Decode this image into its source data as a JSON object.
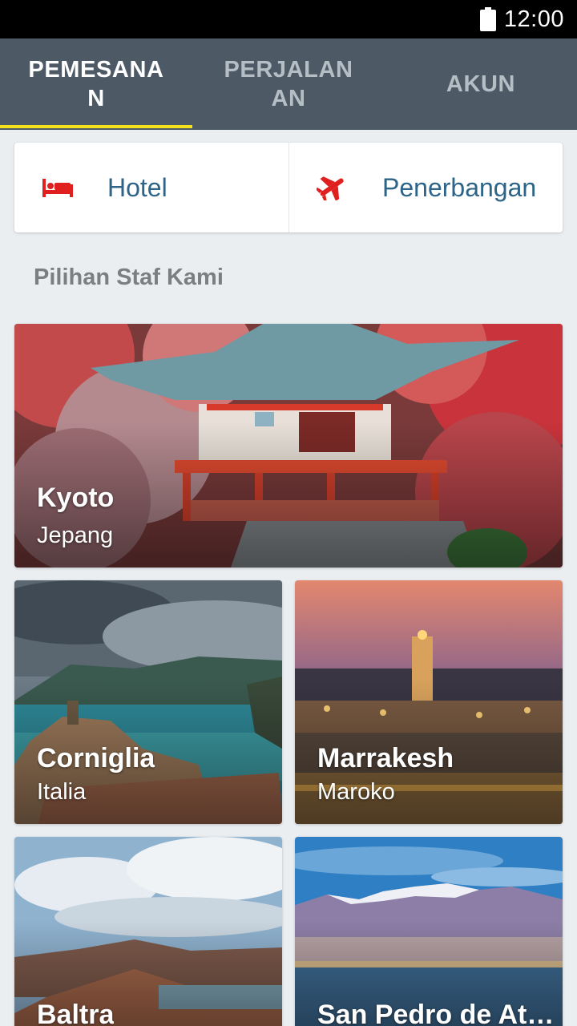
{
  "status_bar": {
    "time": "12:00",
    "battery_icon": "battery-full-icon"
  },
  "tabs": [
    {
      "label": "PEMESANAN",
      "active": true
    },
    {
      "label": "PERJALANAN",
      "active": false
    },
    {
      "label": "AKUN",
      "active": false
    }
  ],
  "booking_types": [
    {
      "label": "Hotel",
      "icon": "bed-icon"
    },
    {
      "label": "Penerbangan",
      "icon": "airplane-icon"
    }
  ],
  "section": {
    "title": "Pilihan Staf Kami"
  },
  "destinations": [
    {
      "city": "Kyoto",
      "country": "Jepang"
    },
    {
      "city": "Corniglia",
      "country": "Italia"
    },
    {
      "city": "Marrakesh",
      "country": "Maroko"
    },
    {
      "city": "Baltra",
      "country": ""
    },
    {
      "city": "San Pedro de Ata…",
      "country": ""
    }
  ],
  "colors": {
    "accent": "#f4e21c",
    "tabbar": "#4d5a66",
    "icon_red": "#e0201f",
    "link_blue": "#2e6487"
  }
}
